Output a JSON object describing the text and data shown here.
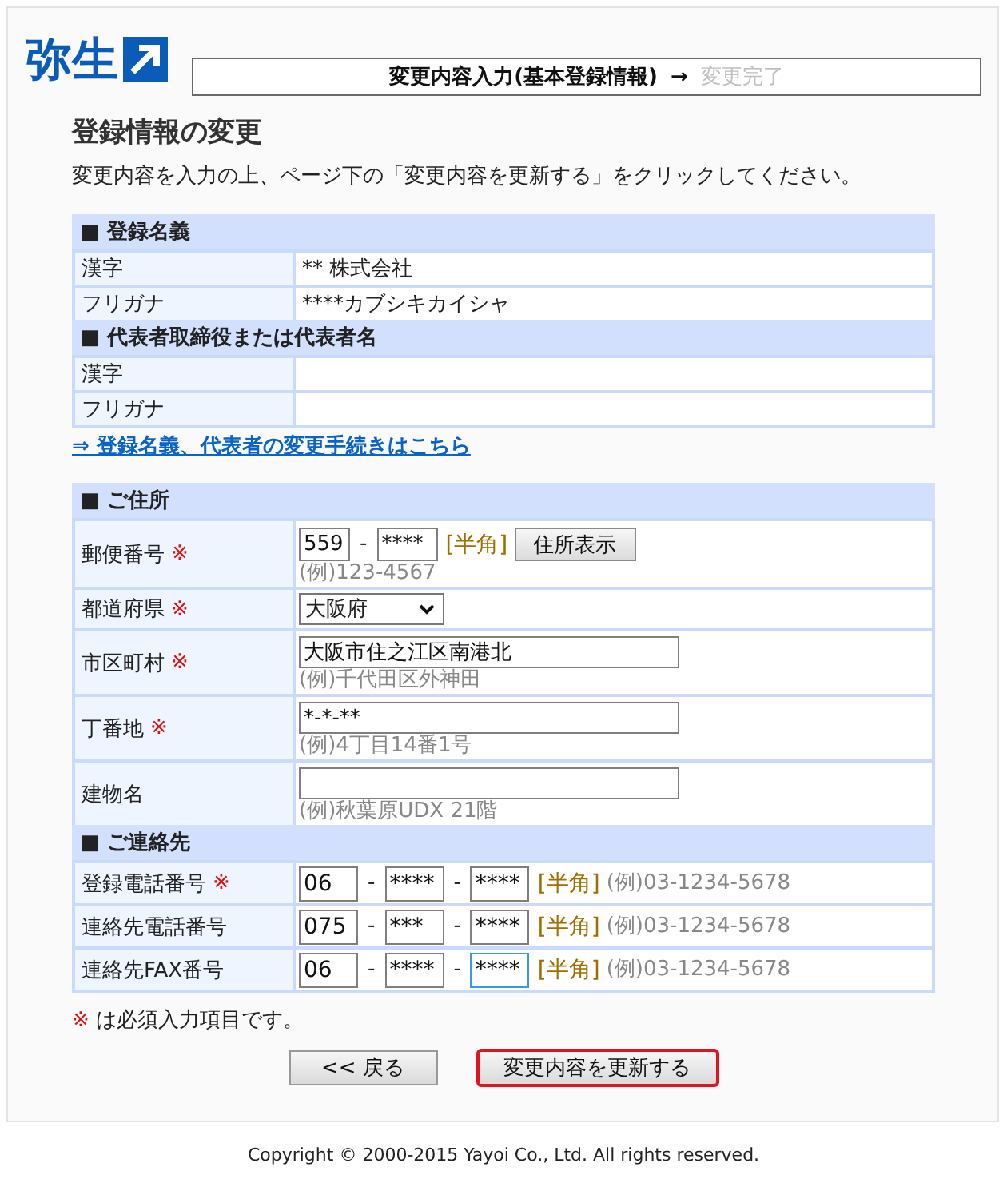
{
  "logo": {
    "text": "弥生"
  },
  "steps": [
    {
      "label": "変更内容入力(基本登録情報)",
      "current": true
    },
    {
      "prefix": "→",
      "label": "変更完了",
      "current": false
    }
  ],
  "heading": "登録情報の変更",
  "intro": "変更内容を入力の上、ページ下の「変更内容を更新する」をクリックしてください。",
  "registration": {
    "sections": [
      {
        "title": "■ 登録名義",
        "rows": [
          {
            "label": "漢字",
            "value": "** 株式会社"
          },
          {
            "label": "フリガナ",
            "value": "****カブシキカイシャ"
          }
        ]
      },
      {
        "title": "■ 代表者取締役または代表者名",
        "rows": [
          {
            "label": "漢字"
          },
          {
            "label": "フリガナ"
          }
        ]
      }
    ]
  },
  "change_link": "⇒ 登録名義、代表者の変更手続きはこちら",
  "form": {
    "sections": [
      {
        "title": "■ ご住所",
        "rows": [
          {
            "kind": "postal",
            "label": "郵便番号",
            "required_mark": "※",
            "parts": [
              {
                "value": "559"
              },
              {
                "prefix": "-",
                "value": "****"
              }
            ],
            "hint": "[半角]",
            "button": "住所表示",
            "example": "(例)123-4567"
          },
          {
            "kind": "select",
            "label": "都道府県",
            "required_mark": "※",
            "value": "大阪府"
          },
          {
            "kind": "text",
            "label": "市区町村",
            "required_mark": "※",
            "value": "大阪市住之江区南港北",
            "example": "(例)千代田区外神田"
          },
          {
            "kind": "text",
            "label": "丁番地",
            "required_mark": "※",
            "value": "*-*-**",
            "example": "(例)4丁目14番1号"
          },
          {
            "kind": "text",
            "label": "建物名",
            "example": "(例)秋葉原UDX 21階"
          }
        ]
      },
      {
        "title": "■ ご連絡先",
        "rows": [
          {
            "kind": "phone",
            "label": "登録電話番号",
            "required_mark": "※",
            "parts": [
              {
                "value": "06",
                "focused": false
              },
              {
                "prefix": "-",
                "value": "****",
                "focused": false
              },
              {
                "prefix": "-",
                "value": "****",
                "focused": false
              }
            ],
            "hint": "[半角]",
            "example": "(例)03-1234-5678"
          },
          {
            "kind": "phone",
            "label": "連絡先電話番号",
            "parts": [
              {
                "value": "075",
                "focused": false
              },
              {
                "prefix": "-",
                "value": "***",
                "focused": false
              },
              {
                "prefix": "-",
                "value": "****",
                "focused": false
              }
            ],
            "hint": "[半角]",
            "example": "(例)03-1234-5678"
          },
          {
            "kind": "phone",
            "label": "連絡先FAX番号",
            "parts": [
              {
                "value": "06",
                "focused": false
              },
              {
                "prefix": "-",
                "value": "****",
                "focused": false
              },
              {
                "prefix": "-",
                "value": "****",
                "focused": true
              }
            ],
            "hint": "[半角]",
            "example": "(例)03-1234-5678"
          }
        ]
      }
    ]
  },
  "required_note": {
    "mark": "※",
    "text": "は必須入力項目です。"
  },
  "buttons": [
    {
      "label": "<< 戻る",
      "focused": false
    },
    {
      "label": "変更内容を更新する",
      "focused": true
    }
  ],
  "footer": "Copyright © 2000-2015 Yayoi Co., Ltd. All rights reserved."
}
